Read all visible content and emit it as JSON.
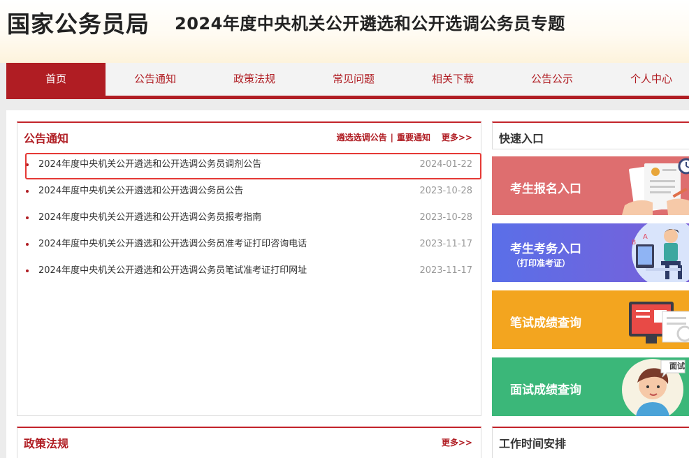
{
  "header": {
    "logo": "国家公务员局",
    "site_title": "2024年度中央机关公开遴选和公开选调公务员专题"
  },
  "nav": {
    "items": [
      "首页",
      "公告通知",
      "政策法规",
      "常见问题",
      "相关下载",
      "公告公示",
      "个人中心"
    ],
    "active": "首页"
  },
  "notice_panel": {
    "title": "公告通知",
    "link1": "遴选选调公告",
    "separator": "|",
    "link2": "重要通知",
    "more": "更多>>",
    "items": [
      {
        "title": "2024年度中央机关公开遴选和公开选调公务员调剂公告",
        "date": "2024-01-22"
      },
      {
        "title": "2024年度中央机关公开遴选和公开选调公务员公告",
        "date": "2023-10-28"
      },
      {
        "title": "2024年度中央机关公开遴选和公开选调公务员报考指南",
        "date": "2023-10-28"
      },
      {
        "title": "2024年度中央机关公开遴选和公开选调公务员准考证打印咨询电话",
        "date": "2023-11-17"
      },
      {
        "title": "2024年度中央机关公开遴选和公开选调公务员笔试准考证打印网址",
        "date": "2023-11-17"
      }
    ]
  },
  "quick_panel": {
    "title": "快速入口",
    "cards": {
      "register": {
        "label": "考生报名入口",
        "color": "#de6e6f"
      },
      "exam": {
        "label": "考生考务入口",
        "sub": "（打印准考证）",
        "color": "#5a6fe8"
      },
      "written": {
        "label": "笔试成绩查询",
        "color": "#f3a51f"
      },
      "interview": {
        "label": "面试成绩查询",
        "badge": "面试",
        "color": "#3bb779"
      }
    }
  },
  "policy_panel": {
    "title": "政策法规",
    "more": "更多>>"
  },
  "work_panel": {
    "title": "工作时间安排"
  },
  "colors": {
    "brand_red": "#b01d23",
    "highlight_border": "#e53935"
  }
}
